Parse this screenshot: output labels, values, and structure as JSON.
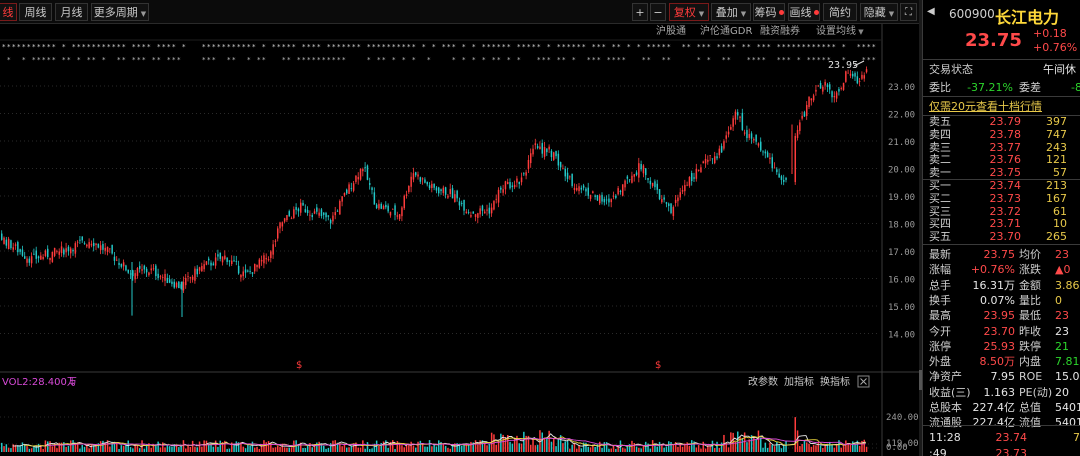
{
  "toolbar": {
    "tabs": [
      {
        "label": "线",
        "name": "tab-minute-line",
        "active": true
      },
      {
        "label": "周线",
        "name": "tab-weekly"
      },
      {
        "label": "月线",
        "name": "tab-monthly"
      },
      {
        "label": "更多周期",
        "name": "tab-more-periods"
      }
    ],
    "plus": "+",
    "minus": "−",
    "restore_label": "复权",
    "overlay_label": "叠加",
    "chip_label": "筹码",
    "draw_label": "画线",
    "simple_label": "简约",
    "hide_label": "隐藏"
  },
  "subbar": {
    "items": [
      "沪股通",
      "沪伦通GDR",
      "融资融券",
      "设置均线"
    ]
  },
  "price_chart": {
    "y_ticks": [
      "23.00",
      "22.00",
      "21.00",
      "20.00",
      "19.00",
      "18.00",
      "17.00",
      "16.00",
      "15.00",
      "14.00"
    ],
    "high_annotation": "23.95",
    "up_color": "#ff3c3c",
    "down_color": "#23c8c8",
    "ex_markers": [
      "$",
      "$"
    ]
  },
  "volume_chart": {
    "label": "VOL2:28.400万",
    "buttons": [
      "改参数",
      "加指标",
      "换指标"
    ],
    "close_icon": "close-icon",
    "y_ticks": [
      "240.00",
      "119.00",
      "0.00"
    ]
  },
  "stock": {
    "code": "600900",
    "name": "长江电力",
    "price": "23.75",
    "change": "+0.18",
    "change_pct": "+0.76%",
    "status_label": "交易状态",
    "status_value": "午间休",
    "wb_label": "委比",
    "wb_value": "-37.21%",
    "wc_label": "委差",
    "wc_value": "-8",
    "level2_link": "仅需20元查看十档行情"
  },
  "asks": [
    {
      "label": "卖五",
      "price": "23.79",
      "vol": "397"
    },
    {
      "label": "卖四",
      "price": "23.78",
      "vol": "747"
    },
    {
      "label": "卖三",
      "price": "23.77",
      "vol": "243"
    },
    {
      "label": "卖二",
      "price": "23.76",
      "vol": "121"
    },
    {
      "label": "卖一",
      "price": "23.75",
      "vol": "57"
    }
  ],
  "bids": [
    {
      "label": "买一",
      "price": "23.74",
      "vol": "213"
    },
    {
      "label": "买二",
      "price": "23.73",
      "vol": "167"
    },
    {
      "label": "买三",
      "price": "23.72",
      "vol": "61"
    },
    {
      "label": "买四",
      "price": "23.71",
      "vol": "10"
    },
    {
      "label": "买五",
      "price": "23.70",
      "vol": "265"
    }
  ],
  "stats": [
    {
      "l1": "最新",
      "v1": "23.75",
      "c1": "r",
      "l2": "均价",
      "v2": "23",
      "c2": "r"
    },
    {
      "l1": "涨幅",
      "v1": "+0.76%",
      "c1": "r",
      "l2": "涨跌",
      "v2": "▲0",
      "c2": "r"
    },
    {
      "l1": "总手",
      "v1": "16.31万",
      "c1": "w",
      "l2": "金额",
      "v2": "3.86",
      "c2": "y"
    },
    {
      "l1": "换手",
      "v1": "0.07%",
      "c1": "w",
      "l2": "量比",
      "v2": "0",
      "c2": "y"
    },
    {
      "l1": "最高",
      "v1": "23.95",
      "c1": "r",
      "l2": "最低",
      "v2": "23",
      "c2": "r"
    },
    {
      "l1": "今开",
      "v1": "23.70",
      "c1": "r",
      "l2": "昨收",
      "v2": "23",
      "c2": "w"
    },
    {
      "l1": "涨停",
      "v1": "25.93",
      "c1": "r",
      "l2": "跌停",
      "v2": "21",
      "c2": "g"
    },
    {
      "l1": "外盘",
      "v1": "8.50万",
      "c1": "r",
      "l2": "内盘",
      "v2": "7.81",
      "c2": "g"
    },
    {
      "l1": "净资产",
      "v1": "7.95",
      "c1": "w",
      "l2": "ROE",
      "v2": "15.0",
      "c2": "w"
    },
    {
      "l1": "收益(三)",
      "v1": "1.163",
      "c1": "w",
      "l2": "PE(动)",
      "v2": "20",
      "c2": "w"
    },
    {
      "l1": "总股本",
      "v1": "227.4亿",
      "c1": "w",
      "l2": "总值",
      "v2": "5401",
      "c2": "w"
    },
    {
      "l1": "流通股",
      "v1": "227.4亿",
      "c1": "w",
      "l2": "流值",
      "v2": "5401",
      "c2": "w"
    }
  ],
  "ticks": [
    {
      "time": "11:28",
      "price": "23.74",
      "vol": "7"
    },
    {
      "time": ":49",
      "price": "23.73",
      "vol": ""
    }
  ]
}
